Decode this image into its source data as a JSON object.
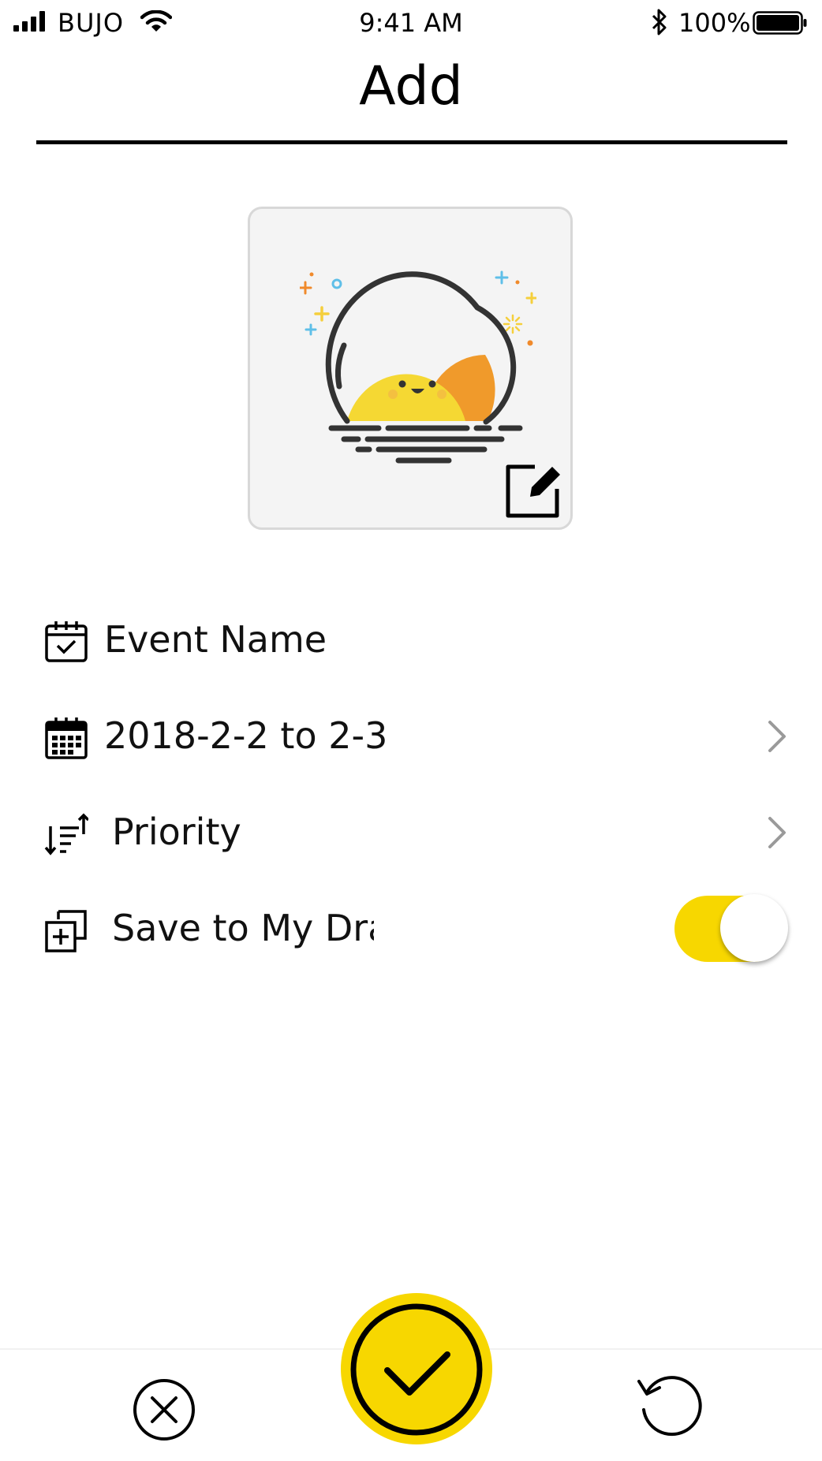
{
  "status_bar": {
    "carrier": "BUJO",
    "time": "9:41 AM",
    "battery": "100%"
  },
  "header": {
    "title": "Add"
  },
  "image_card": {
    "icon": "sunset-sticker",
    "edit_icon": "edit-icon"
  },
  "form": {
    "rows": [
      {
        "icon": "calendar-check-icon",
        "label": "Event Name"
      },
      {
        "icon": "calendar-grid-icon",
        "label": "2018-2-2 to 2-3"
      },
      {
        "icon": "sort-icon",
        "label": "Priority"
      },
      {
        "icon": "add-copy-icon",
        "label": "Save to My Draw"
      }
    ],
    "save_to_draw_enabled": true
  },
  "bottom_bar": {
    "cancel_icon": "close-circle-icon",
    "confirm_icon": "checkmark-icon",
    "reset_icon": "refresh-icon"
  },
  "colors": {
    "accent": "#f7d700",
    "sun": "#f5d833",
    "sun_shadow": "#f09a2b"
  }
}
